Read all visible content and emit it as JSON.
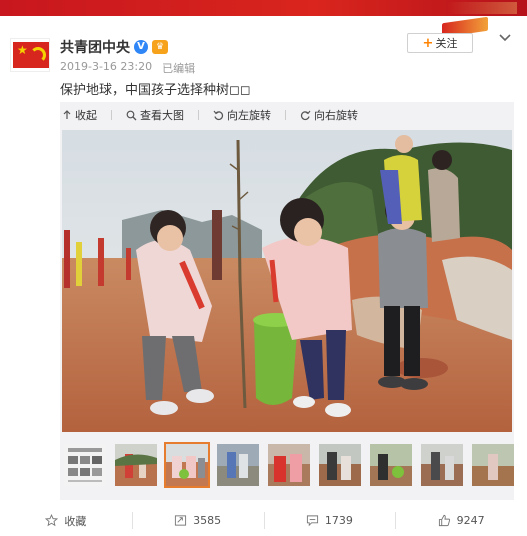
{
  "account": {
    "name": "共青团中央",
    "verified_badge": "V",
    "member_badge": "♛",
    "timestamp": "2019-3-16 23:20",
    "edited_label": "已编辑",
    "follow_label": "关注"
  },
  "post": {
    "text": "保护地球，中国孩子选择种树◻◻"
  },
  "image_toolbar": {
    "collapse": "收起",
    "view_large": "查看大图",
    "rotate_left": "向左旋转",
    "rotate_right": "向右旋转"
  },
  "thumbnails": {
    "count": 9,
    "active_index": 2
  },
  "actions": {
    "favorite": "收藏",
    "repost_count": "3585",
    "comment_count": "1739",
    "like_count": "9247"
  },
  "icons": [
    "flag-icon",
    "verified-icon",
    "crown-icon",
    "chevron-down-icon",
    "collapse-icon",
    "zoom-icon",
    "rotate-left-icon",
    "rotate-right-icon",
    "star-icon",
    "repost-icon",
    "comment-icon",
    "like-icon"
  ],
  "colors": {
    "brand_red": "#d7261e",
    "verified_blue": "#2f86f6",
    "follow_orange": "#ff8200",
    "active_thumb": "#e57c2e"
  }
}
